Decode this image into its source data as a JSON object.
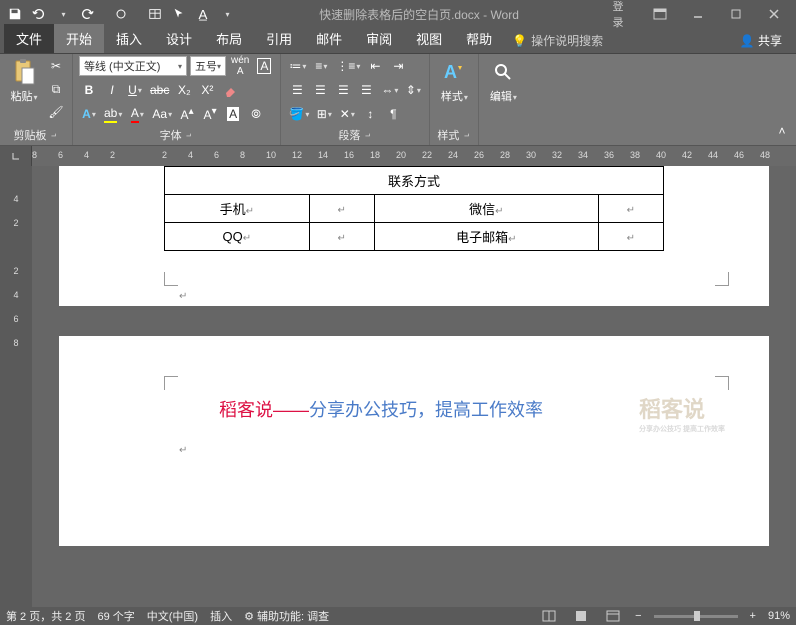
{
  "titlebar": {
    "doc_title": "快速删除表格后的空白页.docx - Word",
    "login": "登录"
  },
  "tabs": {
    "file": "文件",
    "home": "开始",
    "insert": "插入",
    "design": "设计",
    "layout": "布局",
    "references": "引用",
    "mailings": "邮件",
    "review": "审阅",
    "view": "视图",
    "help": "帮助",
    "tell_me": "操作说明搜索",
    "share": "共享"
  },
  "ribbon": {
    "clipboard": {
      "label": "剪贴板",
      "paste": "粘贴"
    },
    "font": {
      "label": "字体",
      "name": "等线 (中文正文)",
      "size": "五号"
    },
    "paragraph": {
      "label": "段落"
    },
    "styles": {
      "label": "样式",
      "btn": "样式"
    },
    "editing": {
      "label": "",
      "btn": "编辑"
    }
  },
  "ruler": {
    "marks": [
      "8",
      "6",
      "4",
      "2",
      "",
      "2",
      "4",
      "6",
      "8",
      "10",
      "12",
      "14",
      "16",
      "18",
      "20",
      "22",
      "24",
      "26",
      "28",
      "30",
      "32",
      "34",
      "36",
      "38",
      "40",
      "42",
      "44",
      "46",
      "48"
    ]
  },
  "vruler": {
    "marks": [
      "",
      "4",
      "2",
      "",
      "2",
      "4",
      "6",
      "8"
    ]
  },
  "doc": {
    "table": {
      "header": "联系方式",
      "r1c1": "手机",
      "r1c3": "微信",
      "r2c1": "QQ",
      "r2c3": "电子邮箱"
    },
    "slogan_red": "稻客说",
    "slogan_dash": "——",
    "slogan_blue": "分享办公技巧，提高工作效率",
    "watermark": "稻客说",
    "watermark_sub": "分享办公技巧 提高工作效率"
  },
  "statusbar": {
    "page": "第 2 页，共 2 页",
    "words": "69 个字",
    "lang": "中文(中国)",
    "mode": "插入",
    "a11y": "辅助功能: 调查",
    "zoom": "91%"
  }
}
